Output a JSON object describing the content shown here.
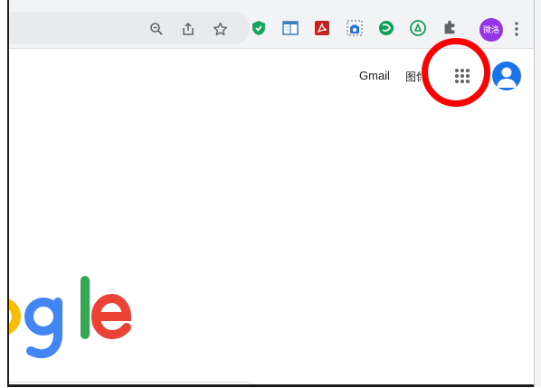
{
  "browser": {
    "omnibox_actions": [
      {
        "name": "zoom-icon"
      },
      {
        "name": "share-icon"
      },
      {
        "name": "bookmark-star-icon"
      }
    ],
    "extensions": [
      {
        "name": "shield-extension-icon",
        "color": "#1aa260"
      },
      {
        "name": "reader-extension-icon",
        "color": "#3c7ac6"
      },
      {
        "name": "pdf-extension-icon",
        "color": "#c5221f"
      },
      {
        "name": "screenshot-extension-icon",
        "color": "#1a73e8"
      },
      {
        "name": "green-circle-extension-icon",
        "color": "#0f9d58"
      },
      {
        "name": "recycle-extension-icon",
        "color": "#0f9d58"
      },
      {
        "name": "puzzle-extensions-icon",
        "color": "#5f6368"
      }
    ],
    "profile_badge": "微洛",
    "profile_color": "#9334e6"
  },
  "header": {
    "gmail": "Gmail",
    "images": "图像"
  },
  "logo": {
    "visible_text": "ogle",
    "colors": {
      "o": "#fbbc05",
      "g": "#4285f4",
      "l": "#34a853",
      "e": "#ea4335"
    }
  },
  "annotation": {
    "color": "#ff0000"
  }
}
